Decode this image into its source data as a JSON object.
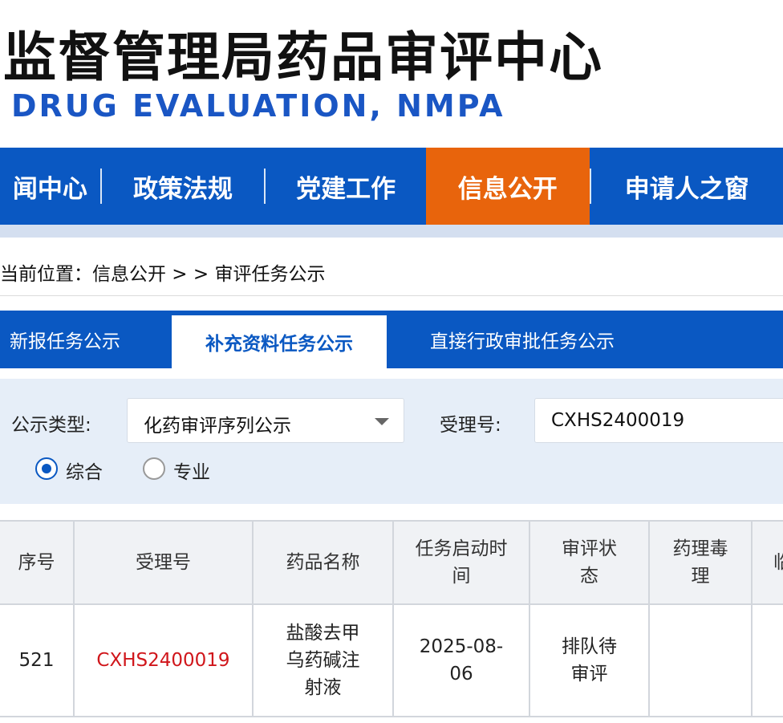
{
  "header": {
    "title_cn": "监督管理局药品审评中心",
    "title_en": "DRUG EVALUATION, NMPA"
  },
  "nav": {
    "items": [
      {
        "label": "闻中心"
      },
      {
        "label": "政策法规"
      },
      {
        "label": "党建工作"
      },
      {
        "label": "信息公开",
        "active": true
      },
      {
        "label": "申请人之窗"
      }
    ]
  },
  "breadcrumb": {
    "text": "当前位置：信息公开 > > 审评任务公示"
  },
  "tabs": [
    {
      "label": "新报任务公示"
    },
    {
      "label": "补充资料任务公示",
      "active": true
    },
    {
      "label": "直接行政审批任务公示"
    }
  ],
  "filter": {
    "type_label": "公示类型:",
    "type_value": "化药审评序列公示",
    "accept_label": "受理号:",
    "accept_value": "CXHS2400019",
    "radio_options": [
      "综合",
      "专业"
    ],
    "radio_selected": "综合"
  },
  "table": {
    "headers": [
      "序号",
      "受理号",
      "药品名称",
      "任务启动时间",
      "审评状态",
      "药理毒理",
      "临"
    ],
    "rows": [
      {
        "seq": "521",
        "accept_no": "CXHS2400019",
        "drug_name": "盐酸去甲乌药碱注射液",
        "start_time": "2025-08-06",
        "status": "排队待审评",
        "pharm_tox": "",
        "extra": ""
      }
    ]
  },
  "colors": {
    "nav_blue": "#0a58c2",
    "nav_active": "#e8640c",
    "link_red": "#d0161b",
    "title_en": "#1a56c4"
  }
}
